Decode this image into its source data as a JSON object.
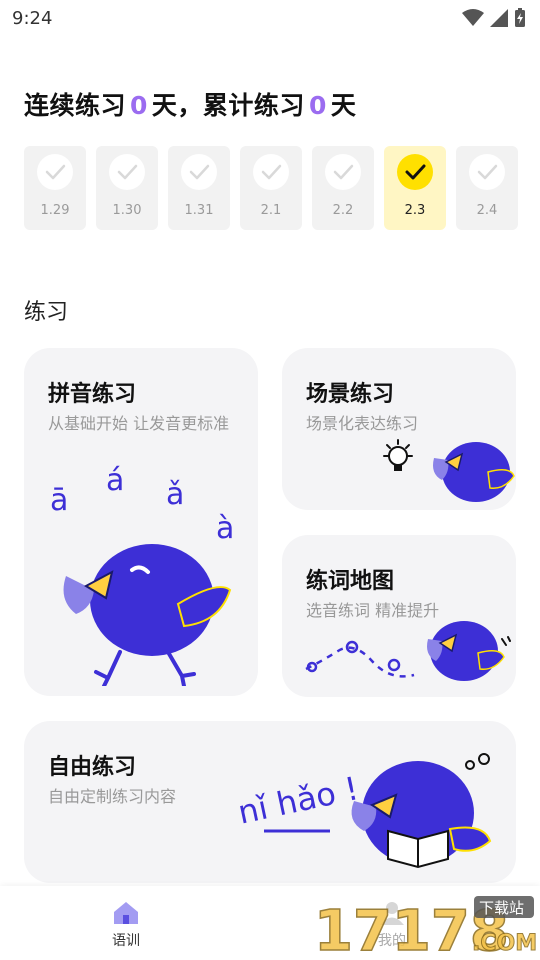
{
  "status_bar": {
    "time": "9:24"
  },
  "streak": {
    "prefix": "连续练习",
    "streak_days": "0",
    "middle": "天，累计练习",
    "total_days": "0",
    "suffix": "天"
  },
  "days": [
    {
      "label": "1.29",
      "checked": false
    },
    {
      "label": "1.30",
      "checked": false
    },
    {
      "label": "1.31",
      "checked": false
    },
    {
      "label": "2.1",
      "checked": false
    },
    {
      "label": "2.2",
      "checked": false
    },
    {
      "label": "2.3",
      "checked": true
    },
    {
      "label": "2.4",
      "checked": false
    }
  ],
  "section": {
    "title": "练习"
  },
  "cards": {
    "pinyin": {
      "title": "拼音练习",
      "subtitle": "从基础开始 让发音更标准"
    },
    "scene": {
      "title": "场景练习",
      "subtitle": "场景化表达练习"
    },
    "map": {
      "title": "练词地图",
      "subtitle": "选音练词 精准提升"
    },
    "free": {
      "title": "自由练习",
      "subtitle": "自由定制练习内容",
      "doodle": "nǐ hǎo !"
    }
  },
  "pinyin_doodles": [
    "ā",
    "á",
    "ǎ",
    "à"
  ],
  "bottom_nav": {
    "home_label": "语训",
    "me_label": "我的"
  },
  "watermark": {
    "text": "17178",
    "tag": "下载站",
    "suffix": ".COM"
  },
  "colors": {
    "accent": "#9b6cf0",
    "bird": "#3d2fd6",
    "highlight": "#ffe000"
  }
}
